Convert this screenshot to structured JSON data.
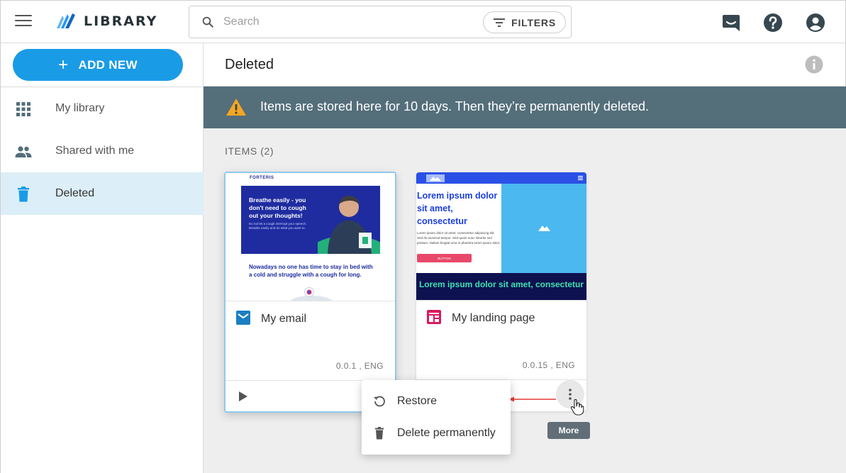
{
  "app": {
    "title": "Library"
  },
  "search": {
    "placeholder": "Search",
    "filters_label": "FILTERS"
  },
  "sidebar": {
    "add_new_label": "ADD NEW",
    "items": [
      {
        "label": "My library",
        "icon": "grid-icon",
        "active": false
      },
      {
        "label": "Shared with me",
        "icon": "people-icon",
        "active": false
      },
      {
        "label": "Deleted",
        "icon": "trash-icon",
        "active": true
      }
    ]
  },
  "page": {
    "title": "Deleted",
    "banner": "Items are stored here for 10 days. Then they’re permanently deleted.",
    "items_label": "ITEMS (2)"
  },
  "cards": [
    {
      "title": "My email",
      "meta": "0.0.1 , ENG",
      "type": "email",
      "thumb": {
        "brand": "FORTERIS",
        "hero": "Breathe easily - you don't need to cough out your thoughts!",
        "hero_sub": "Do not let a cough interrupt your speech. Breathe easily and do what you want to.",
        "subheading": "Nowadays no one has time to stay in bed with a cold and struggle with a cough for long."
      }
    },
    {
      "title": "My landing page",
      "meta": "0.0.15 , ENG",
      "type": "landing-page",
      "thumb": {
        "heading": "Lorem ipsum dolor sit amet, consectetur",
        "paragraph": "Lorem ipsum dolor sit amet, consectetur adipiscing elit. Sed do eiusmod tempor. Sed quam nunc lobortis sed pretium. Nullam feugiat urna in pharetra lorem ipsum dolor.",
        "button": "BUTTON",
        "footer_heading": "Lorem ipsum dolor sit amet, consectetur"
      }
    }
  ],
  "context_menu": {
    "items": [
      {
        "label": "Restore",
        "icon": "restore-icon"
      },
      {
        "label": "Delete permanently",
        "icon": "trash-icon"
      }
    ]
  },
  "tooltip": {
    "label": "More"
  },
  "colors": {
    "accent": "#1a9be6",
    "banner": "#546e7a",
    "active_nav": "#dceef7",
    "warning": "#f5a623",
    "email_icon": "#1a7fc1",
    "landing_icon": "#d81b60"
  }
}
